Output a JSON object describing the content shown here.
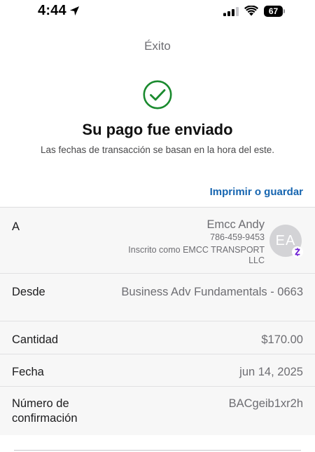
{
  "status_bar": {
    "time": "4:44",
    "battery_level": "67",
    "icons": [
      "location-arrow-icon",
      "cellular-signal-icon",
      "wifi-icon",
      "battery-icon"
    ]
  },
  "header": {
    "title": "Éxito"
  },
  "success": {
    "icon": "check-circle-icon",
    "icon_color": "#1a8a2e",
    "headline": "Su pago fue enviado",
    "subtitle": "Las fechas de transacción se basan en la hora del este."
  },
  "actions": {
    "print_label": "Imprimir o guardar",
    "link_color": "#1665b0"
  },
  "details": {
    "to": {
      "label": "A",
      "name": "Emcc Andy",
      "phone": "786-459-9453",
      "enrolled": "Inscrito como EMCC TRANSPORT LLC",
      "avatar_initials": "EA",
      "badge_icon": "zelle-icon",
      "badge_color": "#6d1ed4"
    },
    "from": {
      "label": "Desde",
      "value": "Business Adv Fundamentals - 0663"
    },
    "amount": {
      "label": "Cantidad",
      "value": "$170.00"
    },
    "date": {
      "label": "Fecha",
      "value": "jun 14, 2025"
    },
    "confirmation": {
      "label": "Número de confirmación",
      "value": "BACgeib1xr2h"
    }
  }
}
